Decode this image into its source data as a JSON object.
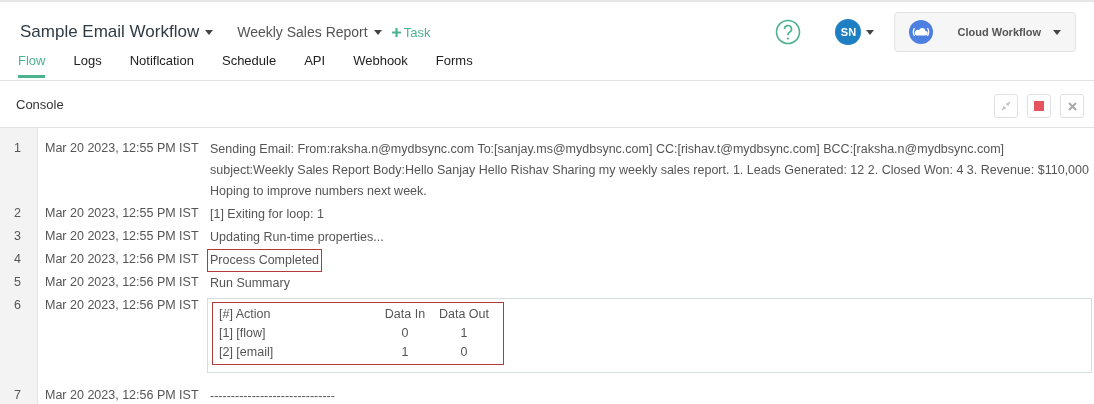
{
  "header": {
    "workflow": "Sample Email Workflow",
    "process": "Weekly Sales Report",
    "add_task": "Task",
    "avatar": "SN",
    "account": "Cloud Workflow"
  },
  "tabs": [
    {
      "label": "Flow",
      "selected": true
    },
    {
      "label": "Logs",
      "selected": false
    },
    {
      "label": "Notiflcation",
      "selected": false
    },
    {
      "label": "Schedule",
      "selected": false
    },
    {
      "label": "API",
      "selected": false
    },
    {
      "label": "Webhook",
      "selected": false
    },
    {
      "label": "Forms",
      "selected": false
    }
  ],
  "console": {
    "title": "Console",
    "lines": [
      {
        "kind": "text",
        "number": "1",
        "time": "Mar 20 2023, 12:55 PM IST",
        "message": "Sending Email: From:raksha.n@mydbsync.com To:[sanjay.ms@mydbsync.com] CC:[rishav.t@mydbsync.com] BCC:[raksha.n@mydbsync.com] subject:Weekly Sales Report Body:Hello Sanjay Hello Rishav Sharing my weekly sales report. 1. Leads Generated: 12 2. Closed Won: 4 3. Revenue: $110,000 Hoping to improve numbers next week.",
        "highlighted": false
      },
      {
        "kind": "text",
        "number": "2",
        "time": "Mar 20 2023, 12:55 PM IST",
        "message": "[1] Exiting for loop: 1",
        "highlighted": false
      },
      {
        "kind": "text",
        "number": "3",
        "time": "Mar 20 2023, 12:55 PM IST",
        "message": "Updating Run-time properties...",
        "highlighted": false
      },
      {
        "kind": "text",
        "number": "4",
        "time": "Mar 20 2023, 12:56 PM IST",
        "message": "Process Completed",
        "highlighted": true
      },
      {
        "kind": "text",
        "number": "5",
        "time": "Mar 20 2023, 12:56 PM IST",
        "message": "Run Summary",
        "highlighted": false
      },
      {
        "kind": "table",
        "number": "6",
        "time": "Mar 20 2023, 12:56 PM IST",
        "highlighted": true,
        "columns": [
          "[#] Action",
          "Data In",
          "Data Out"
        ],
        "rows": [
          [
            "[1] [flow]",
            "0",
            "1"
          ],
          [
            "[2] [email]",
            "1",
            "0"
          ]
        ]
      },
      {
        "kind": "text",
        "number": "7",
        "time": "Mar 20 2023, 12:56 PM IST",
        "message": "------------------------------",
        "highlighted": false
      }
    ]
  }
}
